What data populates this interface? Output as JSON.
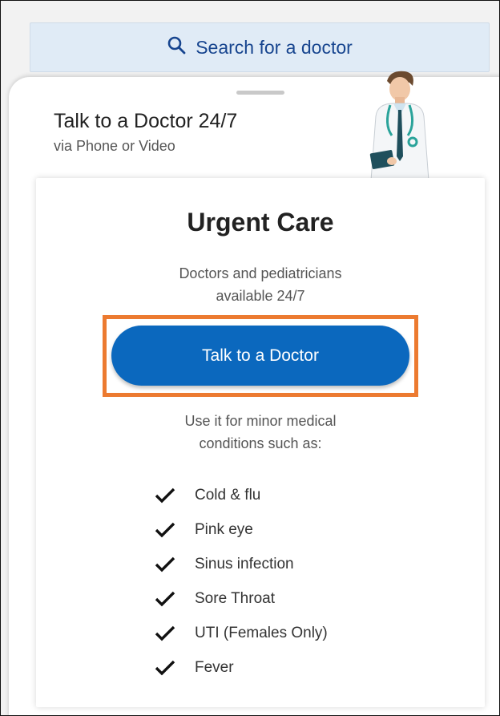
{
  "search": {
    "label": "Search for a doctor",
    "icon": "search-icon"
  },
  "intro": {
    "title": "Talk to a Doctor 24/7",
    "subtitle": "via Phone or Video"
  },
  "card": {
    "title": "Urgent Care",
    "description_line1": "Doctors and pediatricians",
    "description_line2": "available 24/7",
    "cta_label": "Talk to a Doctor",
    "use_line1": "Use it for minor medical",
    "use_line2": "conditions such as:",
    "conditions": [
      "Cold & flu",
      "Pink eye",
      "Sinus infection",
      "Sore Throat",
      "UTI (Females Only)",
      "Fever"
    ]
  },
  "colors": {
    "brand_blue": "#0b68be",
    "search_bg": "#e0ebf6",
    "search_text": "#17458f",
    "highlight": "#ec7a30"
  }
}
